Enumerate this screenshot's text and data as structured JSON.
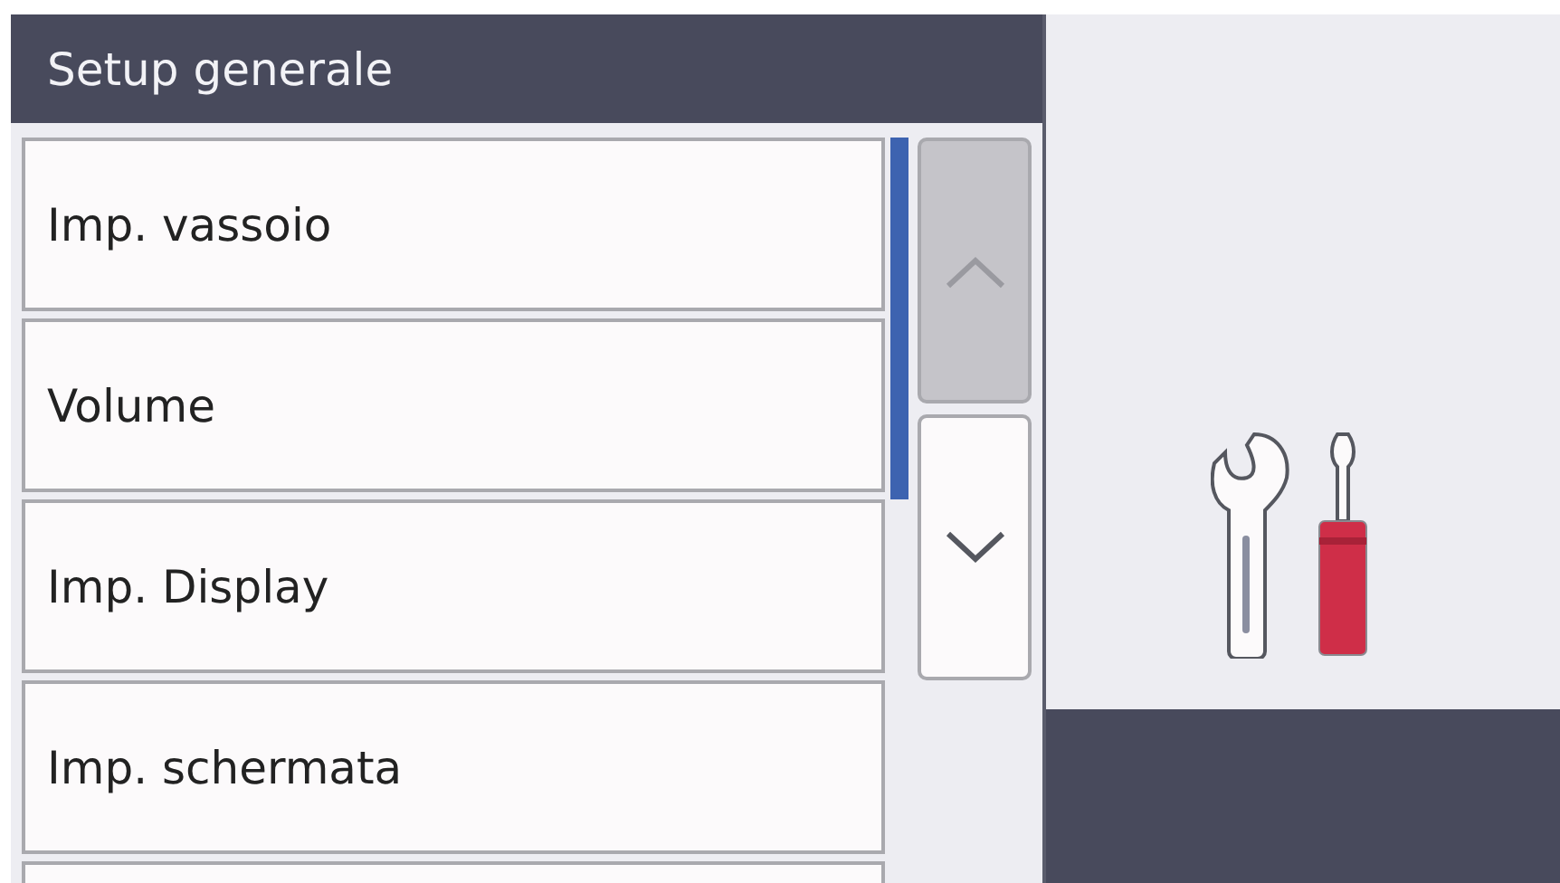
{
  "header": {
    "title": "Setup generale"
  },
  "menu_items": [
    {
      "label": "Imp. vassoio"
    },
    {
      "label": "Volume"
    },
    {
      "label": "Imp. Display"
    },
    {
      "label": "Imp. schermata"
    }
  ],
  "scroll_buttons": [
    {
      "kind": "up",
      "disabled": true
    },
    {
      "kind": "down",
      "disabled": false
    }
  ]
}
